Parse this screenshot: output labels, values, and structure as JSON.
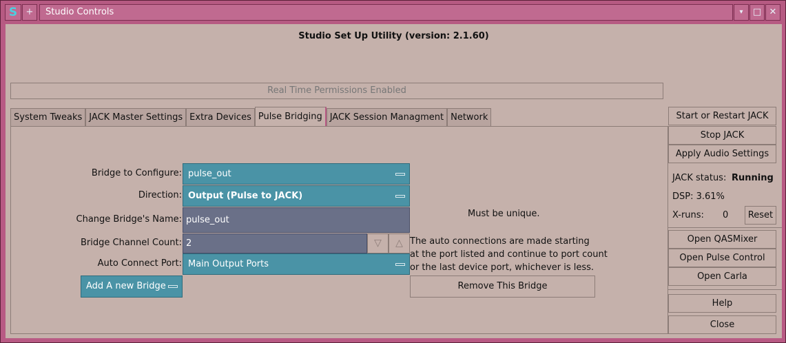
{
  "window": {
    "icon_glyph": "S",
    "plus_glyph": "+",
    "title": "Studio Controls",
    "min_glyph": "▾",
    "max_glyph": "□",
    "close_glyph": "✕"
  },
  "header": {
    "title": "Studio Set Up Utility (version: 2.1.60)",
    "rt_status": "Real Time Permissions Enabled"
  },
  "tabs": [
    {
      "label": "System Tweaks"
    },
    {
      "label": "JACK Master Settings"
    },
    {
      "label": "Extra Devices"
    },
    {
      "label": "Pulse Bridging"
    },
    {
      "label": "JACK Session Managment"
    },
    {
      "label": "Network"
    }
  ],
  "pulse": {
    "bridge_label": "Bridge to Configure:",
    "bridge_value": "pulse_out",
    "direction_label": "Direction:",
    "direction_value": "Output (Pulse to JACK)",
    "name_label": "Change Bridge's Name:",
    "name_value": "pulse_out",
    "name_note": "Must be unique.",
    "count_label": "Bridge Channel Count:",
    "count_value": "2",
    "count_down": "▽",
    "count_up": "△",
    "auto_label": "Auto Connect Port:",
    "auto_value": "Main Output Ports",
    "auto_note_1": "The auto connections are made starting",
    "auto_note_2": "at the port listed and continue to port count",
    "auto_note_3": "or the last device port, whichever is less.",
    "add_button": "Add A new Bridge",
    "remove_button": "Remove This Bridge"
  },
  "side": {
    "start_jack": "Start or Restart  JACK",
    "stop_jack": "Stop JACK",
    "apply_audio": "Apply Audio Settings",
    "status_label": "JACK status:",
    "status_value": "Running",
    "dsp": "DSP: 3.61%",
    "xruns_label": "X-runs:",
    "xruns_value": "0",
    "reset": "Reset",
    "open_qasmixer": "Open QASMixer",
    "open_pulse": "Open Pulse Control",
    "open_carla": "Open Carla",
    "help": "Help",
    "close": "Close"
  }
}
